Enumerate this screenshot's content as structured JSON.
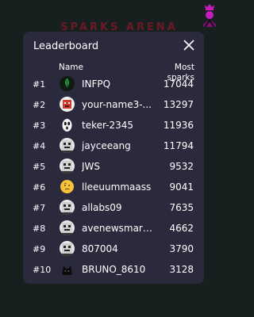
{
  "backdrop": {
    "text": "SPARKS ARENA"
  },
  "modal": {
    "title": "Leaderboard",
    "columns": {
      "name": "Name",
      "sparks": "Most sparks"
    }
  },
  "rows": [
    {
      "rank": "#1",
      "name": "INFPQ",
      "score": "17044",
      "avatar": "green-leaf-avatar"
    },
    {
      "rank": "#2",
      "name": "your-name3-...",
      "score": "13297",
      "avatar": "red-robot-avatar"
    },
    {
      "rank": "#3",
      "name": "teker-2345",
      "score": "11936",
      "avatar": "ghost-face-avatar"
    },
    {
      "rank": "#4",
      "name": "jayceeang",
      "score": "11794",
      "avatar": "pixel-robot-avatar"
    },
    {
      "rank": "#5",
      "name": "JWS",
      "score": "9532",
      "avatar": "pixel-robot-avatar"
    },
    {
      "rank": "#6",
      "name": "lleeuummaass",
      "score": "9041",
      "avatar": "thinking-emoji-avatar"
    },
    {
      "rank": "#7",
      "name": "allabs09",
      "score": "7635",
      "avatar": "pixel-robot-avatar"
    },
    {
      "rank": "#8",
      "name": "avenewsmart...",
      "score": "4662",
      "avatar": "pixel-robot-avatar"
    },
    {
      "rank": "#9",
      "name": "807004",
      "score": "3790",
      "avatar": "pixel-robot-avatar"
    },
    {
      "rank": "#10",
      "name": "BRUNO_8610",
      "score": "3128",
      "avatar": "black-cat-avatar"
    }
  ],
  "colors": {
    "background": "#17201e",
    "modal": "#2b2a3d",
    "crown": "#c61bbd"
  }
}
